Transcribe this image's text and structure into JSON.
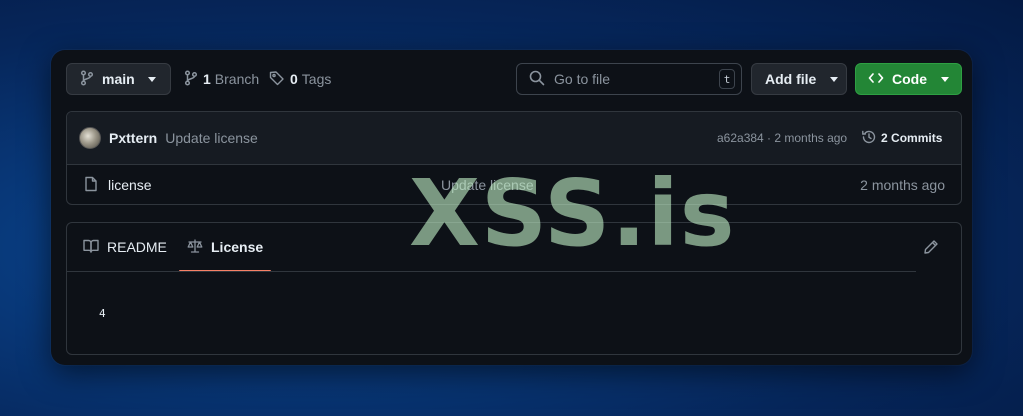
{
  "toolbar": {
    "branch_name": "main",
    "branch_count": "1",
    "branch_label": "Branch",
    "tag_count": "0",
    "tag_label": "Tags",
    "search_placeholder": "Go to file",
    "search_shortcut": "t",
    "add_file_label": "Add file",
    "code_label": "Code",
    "code_button_color": "#238636"
  },
  "latest_commit": {
    "author": "Pxttern",
    "message": "Update license",
    "meta": "a62a384 · 2 months ago",
    "commits_count": "2",
    "commits_label": "Commits"
  },
  "files": [
    {
      "name": "license",
      "icon": "file-icon",
      "message": "Update license",
      "date": "2 months ago"
    }
  ],
  "tabs": {
    "readme_label": "README",
    "license_label": "License",
    "active_tab": "License",
    "active_underline_color": "#f78166"
  },
  "license_content": "4",
  "watermark": "XSS.is",
  "icons": [
    "branch-icon",
    "tag-icon",
    "search-icon",
    "code-brackets-icon",
    "history-icon",
    "file-icon",
    "book-icon",
    "scale-icon",
    "pencil-icon"
  ]
}
